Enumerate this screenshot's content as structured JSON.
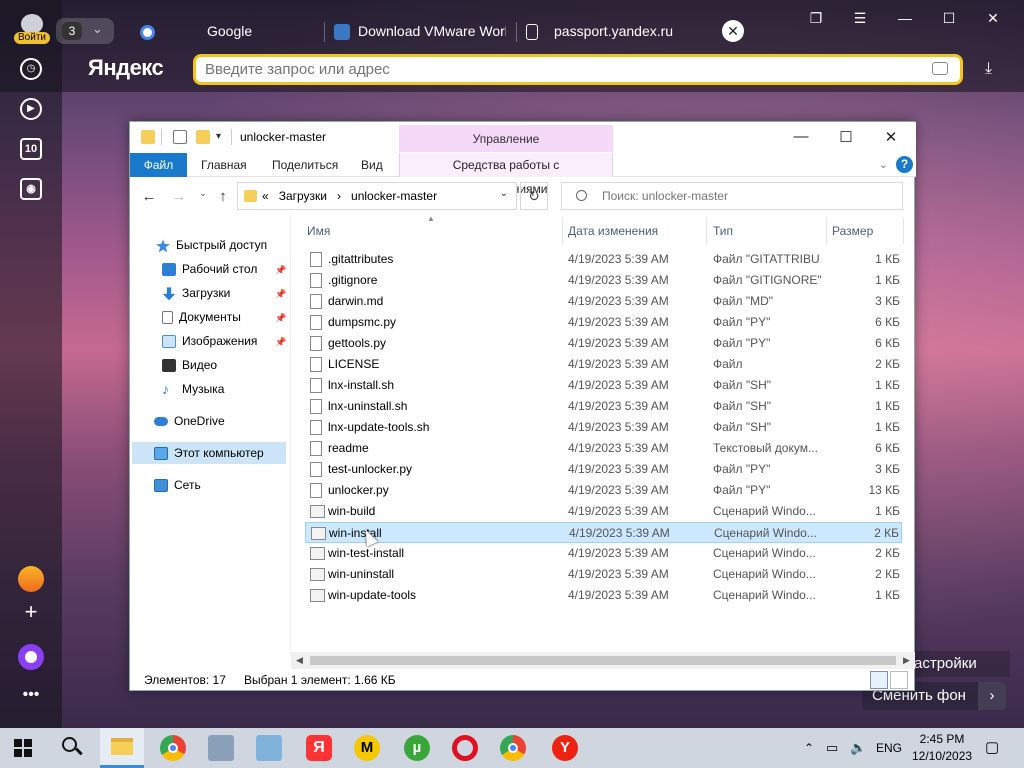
{
  "browser": {
    "login_label": "Войти",
    "tab_count": "3",
    "tabs": [
      {
        "label": "Google"
      },
      {
        "label": "Download VMware Work"
      },
      {
        "label": "passport.yandex.ru"
      }
    ],
    "brand": "Яндекс",
    "omnibox_placeholder": "Введите запрос или адрес",
    "sidebar_counter": "10",
    "settings_btn": "астройки",
    "change_bg_btn": "Сменить фон"
  },
  "explorer": {
    "title": "unlocker-master",
    "contextual_group": "Управление",
    "ribbon_tabs": [
      "Файл",
      "Главная",
      "Поделиться",
      "Вид"
    ],
    "contextual_tab": "Средства работы с приложениями",
    "address": {
      "prefix": "«",
      "part1": "Загрузки",
      "sep": "›",
      "part2": "unlocker-master"
    },
    "search_placeholder": "Поиск: unlocker-master",
    "nav": {
      "quick_access": "Быстрый доступ",
      "desktop": "Рабочий стол",
      "downloads": "Загрузки",
      "documents": "Документы",
      "pictures": "Изображения",
      "video": "Видео",
      "music": "Музыка",
      "onedrive": "OneDrive",
      "this_pc": "Этот компьютер",
      "network": "Сеть"
    },
    "columns": {
      "name": "Имя",
      "date": "Дата изменения",
      "type": "Тип",
      "size": "Размер"
    },
    "files": [
      {
        "name": ".gitattributes",
        "date": "4/19/2023 5:39 AM",
        "type": "Файл \"GITATTRIBU...",
        "size": "1 КБ"
      },
      {
        "name": ".gitignore",
        "date": "4/19/2023 5:39 AM",
        "type": "Файл \"GITIGNORE\"",
        "size": "1 КБ"
      },
      {
        "name": "darwin.md",
        "date": "4/19/2023 5:39 AM",
        "type": "Файл \"MD\"",
        "size": "3 КБ"
      },
      {
        "name": "dumpsmc.py",
        "date": "4/19/2023 5:39 AM",
        "type": "Файл \"PY\"",
        "size": "6 КБ"
      },
      {
        "name": "gettools.py",
        "date": "4/19/2023 5:39 AM",
        "type": "Файл \"PY\"",
        "size": "6 КБ"
      },
      {
        "name": "LICENSE",
        "date": "4/19/2023 5:39 AM",
        "type": "Файл",
        "size": "2 КБ"
      },
      {
        "name": "lnx-install.sh",
        "date": "4/19/2023 5:39 AM",
        "type": "Файл \"SH\"",
        "size": "1 КБ"
      },
      {
        "name": "lnx-uninstall.sh",
        "date": "4/19/2023 5:39 AM",
        "type": "Файл \"SH\"",
        "size": "1 КБ"
      },
      {
        "name": "lnx-update-tools.sh",
        "date": "4/19/2023 5:39 AM",
        "type": "Файл \"SH\"",
        "size": "1 КБ"
      },
      {
        "name": "readme",
        "date": "4/19/2023 5:39 AM",
        "type": "Текстовый докум...",
        "size": "6 КБ"
      },
      {
        "name": "test-unlocker.py",
        "date": "4/19/2023 5:39 AM",
        "type": "Файл \"PY\"",
        "size": "3 КБ"
      },
      {
        "name": "unlocker.py",
        "date": "4/19/2023 5:39 AM",
        "type": "Файл \"PY\"",
        "size": "13 КБ"
      },
      {
        "name": "win-build",
        "date": "4/19/2023 5:39 AM",
        "type": "Сценарий Windo...",
        "size": "1 КБ"
      },
      {
        "name": "win-install",
        "date": "4/19/2023 5:39 AM",
        "type": "Сценарий Windo...",
        "size": "2 КБ"
      },
      {
        "name": "win-test-install",
        "date": "4/19/2023 5:39 AM",
        "type": "Сценарий Windo...",
        "size": "2 КБ"
      },
      {
        "name": "win-uninstall",
        "date": "4/19/2023 5:39 AM",
        "type": "Сценарий Windo...",
        "size": "2 КБ"
      },
      {
        "name": "win-update-tools",
        "date": "4/19/2023 5:39 AM",
        "type": "Сценарий Windo...",
        "size": "1 КБ"
      }
    ],
    "status_count": "Элементов: 17",
    "status_selection": "Выбран 1 элемент: 1.66 КБ"
  },
  "taskbar": {
    "lang": "ENG",
    "time": "2:45 PM",
    "date": "12/10/2023"
  }
}
